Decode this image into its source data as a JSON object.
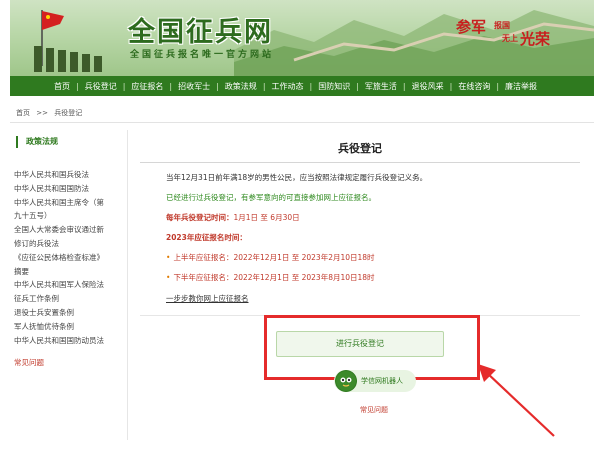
{
  "header": {
    "site_title": "全国征兵网",
    "subtitle": "全国征兵报名唯一官方网站",
    "slogan": {
      "part1": "参军",
      "part2": "报国",
      "part3": "无上",
      "part4": "光荣"
    }
  },
  "nav": {
    "items": [
      "首页",
      "兵役登记",
      "应征报名",
      "招收军士",
      "政策法规",
      "工作动态",
      "国防知识",
      "军旅生活",
      "退役风采",
      "在线咨询",
      "廉洁举报"
    ]
  },
  "breadcrumb": {
    "home": "首页",
    "sep": ">>",
    "current": "兵役登记"
  },
  "sidebar": {
    "heading": "政策法规",
    "items": [
      "中华人民共和国兵役法",
      "中华人民共和国国防法",
      "中华人民共和国主席令（第",
      "九十五号）",
      "全国人大常委会审议通过新",
      "修订的兵役法",
      "《应征公民体格检查标准》",
      "摘要",
      "中华人民共和国军人保险法",
      "征兵工作条例",
      "退役士兵安置条例",
      "军人抚恤优待条例",
      "中华人民共和国国防动员法"
    ],
    "faq": "常见问题"
  },
  "main": {
    "title": "兵役登记",
    "p1": "当年12月31日前年满18岁的男性公民，应当按照法律规定履行兵役登记义务。",
    "p2": "已经进行过兵役登记，有参军意向的可直接参加网上应征报名。",
    "p3_label": "每年兵役登记时间：",
    "p3_value": "1月1日 至 6月30日",
    "p4": "2023年应征报名时间：",
    "p5_label": "上半年应征报名：",
    "p5_value": "2022年12月1日 至 2023年2月10日18时",
    "p6_label": "下半年应征报名：",
    "p6_value": "2022年12月1日 至 2023年8月10日18时",
    "p7": "一步步教你网上应征报名",
    "register_button": "进行兵役登记",
    "robot_label": "学信网机器人",
    "faq": "常见问题"
  },
  "colors": {
    "brand_green": "#2f7a1f",
    "highlight_red": "#e52b2b",
    "text_red": "#c0392b"
  }
}
